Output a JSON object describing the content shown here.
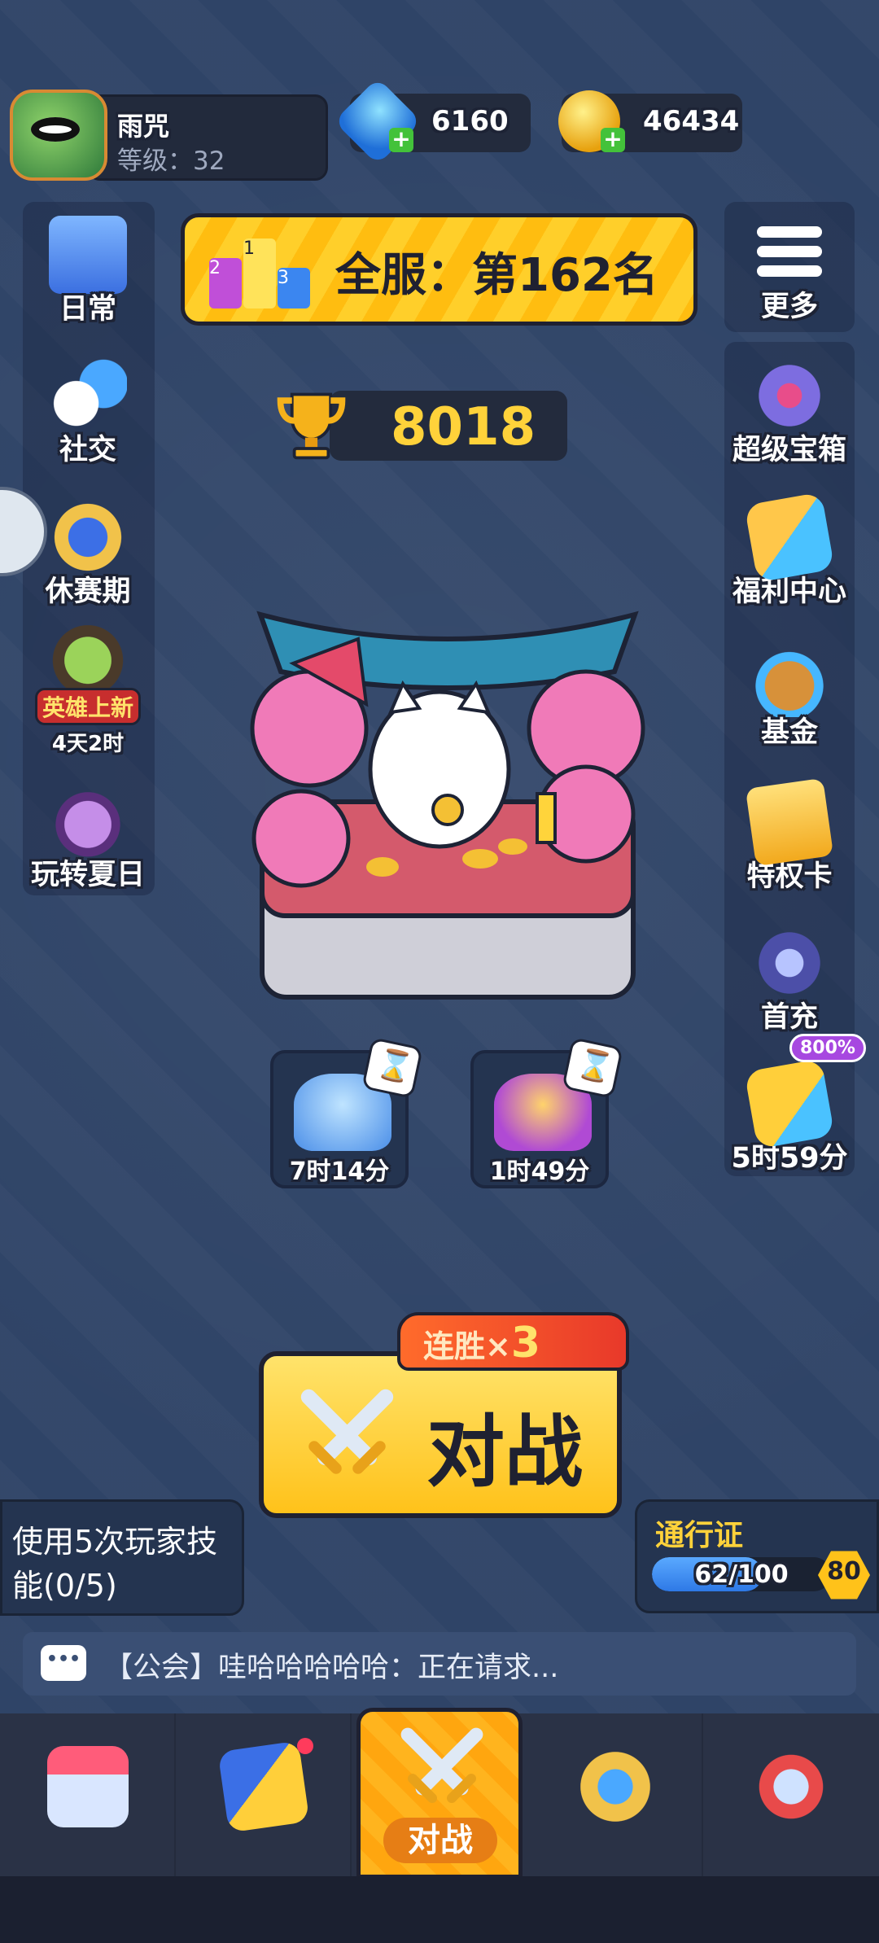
{
  "profile": {
    "name": "雨咒",
    "level_label": "等级：32"
  },
  "currency": {
    "gems": "6160",
    "gold": "46434"
  },
  "rank": {
    "text": "全服：第162名",
    "podium": [
      "2",
      "1",
      "3"
    ]
  },
  "trophies": "8018",
  "left_menu": [
    {
      "label": "日常",
      "icon": "clipboard-icon"
    },
    {
      "label": "社交",
      "icon": "chat-faces-icon"
    },
    {
      "label": "休赛期",
      "icon": "season-badge-icon"
    },
    {
      "label": "英雄上新",
      "sub": "4天2时",
      "icon": "hero-icon"
    },
    {
      "label": "玩转夏日",
      "icon": "summer-cat-icon"
    }
  ],
  "right_menu": {
    "more_label": "更多",
    "items": [
      {
        "label": "超级宝箱",
        "icon": "super-chest-icon"
      },
      {
        "label": "福利中心",
        "icon": "welfare-icon"
      },
      {
        "label": "基金",
        "icon": "fund-bag-icon"
      },
      {
        "label": "特权卡",
        "icon": "privilege-card-icon"
      },
      {
        "label": "首充",
        "icon": "first-recharge-icon"
      },
      {
        "label": "5时59分",
        "badge": "800%",
        "icon": "bonus-cards-icon"
      }
    ]
  },
  "chests": [
    {
      "timer": "7时14分"
    },
    {
      "timer": "1时49分"
    }
  ],
  "battle": {
    "label": "对战",
    "streak_prefix": "连胜×",
    "streak_count": "3"
  },
  "task": {
    "text": "使用5次玩家技能(0/5)"
  },
  "pass": {
    "title": "通行证",
    "progress_text": "62/100",
    "progress_fraction": 0.62,
    "level": "80"
  },
  "chat": {
    "message": "【公会】哇哈哈哈哈哈：正在请求..."
  },
  "nav": {
    "active_label": "对战"
  },
  "colors": {
    "background": "#2f4467",
    "accent": "#ffc21a",
    "outline": "#1f2131"
  }
}
